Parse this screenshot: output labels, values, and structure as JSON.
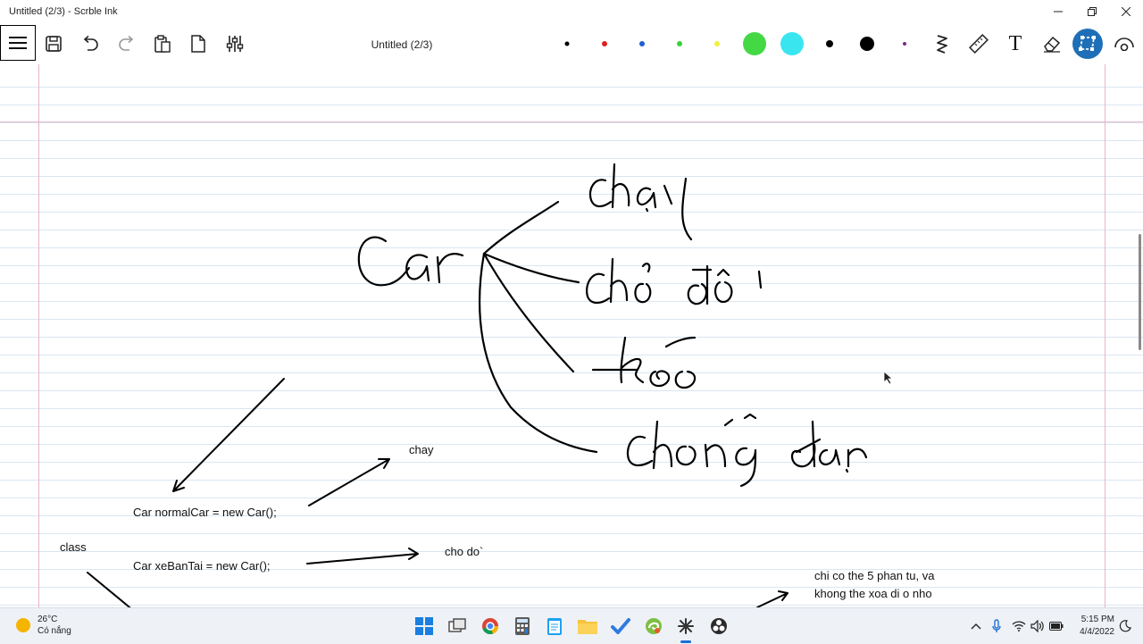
{
  "window": {
    "title": "Untitled (2/3) - Scrble Ink"
  },
  "toolbar": {
    "doc_title": "Untitled (2/3)",
    "tools": [
      "menu-icon",
      "save-icon",
      "undo-icon",
      "redo-icon",
      "paste-icon",
      "page-icon",
      "settings-sliders-icon"
    ],
    "pens": [
      {
        "color": "#000000",
        "size": "small"
      },
      {
        "color": "#e02020",
        "size": "small"
      },
      {
        "color": "#1f5fd1",
        "size": "small"
      },
      {
        "color": "#3ad13a",
        "size": "small"
      },
      {
        "color": "#f0f040",
        "size": "small"
      },
      {
        "color": "#44d944",
        "size": "large"
      },
      {
        "color": "#39e6f0",
        "size": "large"
      },
      {
        "color": "#000000",
        "size": "medium"
      },
      {
        "color": "#000000",
        "size": "large"
      },
      {
        "color": "#7a2a8a",
        "size": "tiny"
      }
    ],
    "right_tools": [
      "squiggle-icon",
      "ruler-icon",
      "text-icon",
      "eraser-icon",
      "lasso-select-icon",
      "view-icon"
    ],
    "text_tool_glyph": "T"
  },
  "canvas": {
    "notes": {
      "chay": "chay",
      "normal_car": "Car normalCar = new Car();",
      "class_label": "class",
      "xe_ban_tai": "Car xeBanTai = new Car();",
      "cho_do": "cho do`",
      "note_line1": "chi co the 5 phan tu, va",
      "note_line2": "khong the xoa di o nho"
    }
  },
  "taskbar": {
    "temperature": "26°C",
    "weather_desc": "Có nắng",
    "apps": [
      "windows-start-icon",
      "task-view-icon",
      "chrome-icon",
      "calculator-icon",
      "notepad-icon",
      "file-explorer-icon",
      "todo-icon",
      "browser-swirl-icon",
      "scrble-ink-icon",
      "obs-icon"
    ],
    "time": "5:15 PM",
    "date": "4/4/2022"
  }
}
